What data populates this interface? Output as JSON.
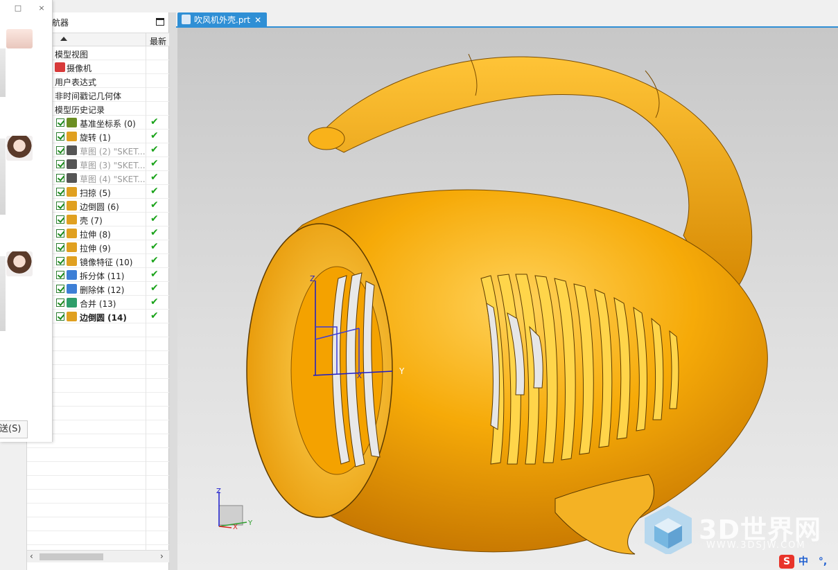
{
  "chat": {
    "send_label": "送(S)",
    "minimize_glyph": "□",
    "close_glyph": "×"
  },
  "navigator": {
    "title": "航器",
    "column_latest": "最新",
    "rows": [
      {
        "label": "模型视图",
        "checked": false,
        "latest": ""
      },
      {
        "label": "摄像机",
        "checked": false,
        "latest": ""
      },
      {
        "label": "用户表达式",
        "checked": false,
        "latest": ""
      },
      {
        "label": "非时间戳记几何体",
        "checked": false,
        "latest": ""
      },
      {
        "label": "模型历史记录",
        "checked": false,
        "latest": ""
      },
      {
        "label": "基准坐标系 (0)",
        "checked": true,
        "latest": "✔",
        "icon": "datum-csys-icon",
        "color": "#6b8e23"
      },
      {
        "label": "旋转 (1)",
        "checked": true,
        "latest": "✔",
        "icon": "revolve-icon",
        "color": "#e0a020"
      },
      {
        "label": "草图 (2) \"SKET...",
        "checked": true,
        "latest": "✔",
        "icon": "sketch-icon",
        "color": "#555555",
        "grey": true
      },
      {
        "label": "草图 (3) \"SKET...",
        "checked": true,
        "latest": "✔",
        "icon": "sketch-icon",
        "color": "#555555",
        "grey": true
      },
      {
        "label": "草图 (4) \"SKET...",
        "checked": true,
        "latest": "✔",
        "icon": "sketch-icon",
        "color": "#555555",
        "grey": true
      },
      {
        "label": "扫掠 (5)",
        "checked": true,
        "latest": "✔",
        "icon": "sweep-icon",
        "color": "#e0a020"
      },
      {
        "label": "边倒圆 (6)",
        "checked": true,
        "latest": "✔",
        "icon": "edge-blend-icon",
        "color": "#e0a020"
      },
      {
        "label": "壳 (7)",
        "checked": true,
        "latest": "✔",
        "icon": "shell-icon",
        "color": "#e0a020"
      },
      {
        "label": "拉伸 (8)",
        "checked": true,
        "latest": "✔",
        "icon": "extrude-icon",
        "color": "#e0a020"
      },
      {
        "label": "拉伸 (9)",
        "checked": true,
        "latest": "✔",
        "icon": "extrude-icon",
        "color": "#e0a020"
      },
      {
        "label": "镜像特征 (10)",
        "checked": true,
        "latest": "✔",
        "icon": "mirror-icon",
        "color": "#e0a020"
      },
      {
        "label": "拆分体 (11)",
        "checked": true,
        "latest": "✔",
        "icon": "split-body-icon",
        "color": "#3d7fd6"
      },
      {
        "label": "删除体 (12)",
        "checked": true,
        "latest": "✔",
        "icon": "delete-body-icon",
        "color": "#3d7fd6"
      },
      {
        "label": "合并 (13)",
        "checked": true,
        "latest": "✔",
        "icon": "unite-icon",
        "color": "#2e9e6a"
      },
      {
        "label": "边倒圆 (14)",
        "checked": true,
        "latest": "✔",
        "icon": "edge-blend-icon",
        "color": "#e0a020",
        "bold": true
      }
    ]
  },
  "tab": {
    "filename": "吹风机外壳.prt",
    "close_glyph": "✕"
  },
  "viewport": {
    "csys_z": "Z",
    "csys_y": "Y",
    "csys_x": "X",
    "triad_z": "Z",
    "triad_x": "X",
    "triad_y": "Y",
    "model_color": "#f5a800"
  },
  "watermark": {
    "title": "3D世界网",
    "url": "WWW.3DSJW.COM"
  },
  "ime": {
    "logo": "S",
    "mode": "中",
    "punct": "°,"
  }
}
